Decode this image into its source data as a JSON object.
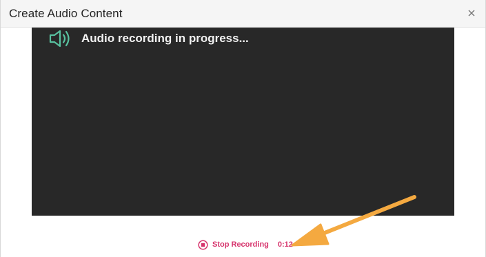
{
  "dialog": {
    "title": "Create Audio Content"
  },
  "recorder": {
    "status_text": "Audio recording in progress...",
    "stop_label": "Stop Recording",
    "elapsed": "0:12"
  },
  "colors": {
    "speaker_icon": "#58c2a0",
    "recording_accent": "#d6336c",
    "annotation_arrow": "#f4a940"
  }
}
